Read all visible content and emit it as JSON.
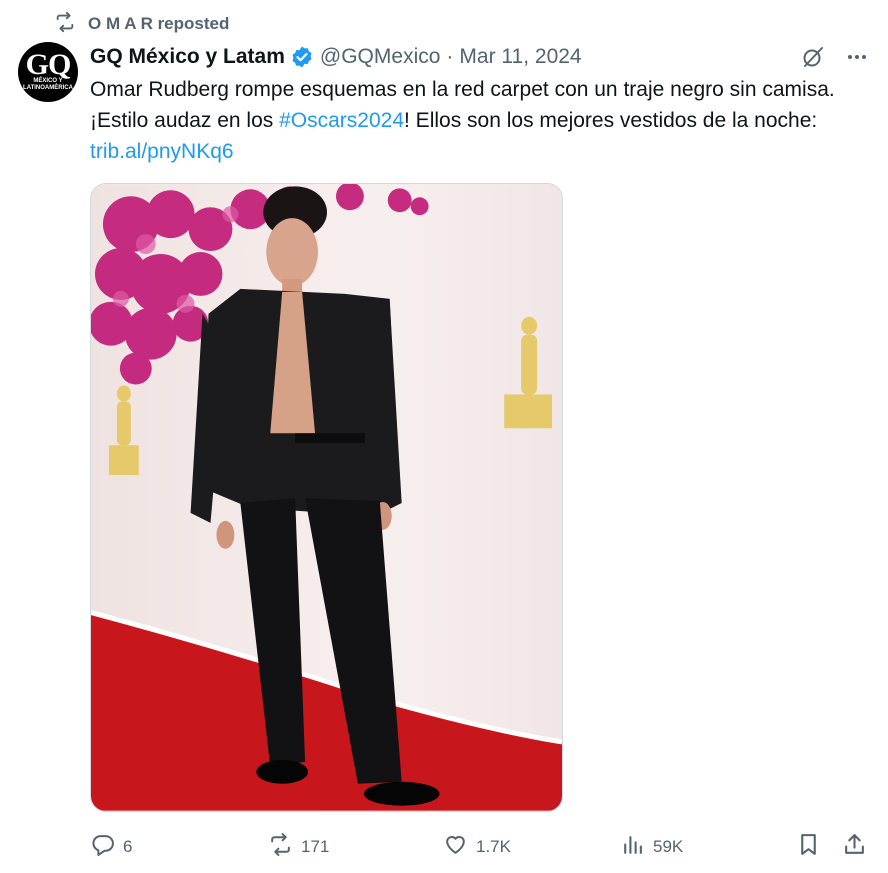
{
  "repost": {
    "label": "O M A R reposted"
  },
  "avatar": {
    "logo_text": "GQ",
    "logo_sub": "MÉXICO Y LATINOAMÉRICA"
  },
  "author": {
    "name": "GQ México y Latam",
    "handle": "@GQMexico",
    "separator": "·",
    "date": "Mar 11, 2024"
  },
  "tweet": {
    "text_part1": "Omar Rudberg rompe esquemas en la red carpet con un traje negro sin camisa. ¡Estilo audaz en los ",
    "hashtag": "#Oscars2024",
    "text_part2": "! Ellos son los mejores vestidos de la noche: ",
    "link": "trib.al/pnyNKq6"
  },
  "actions": {
    "replies": "6",
    "reposts": "171",
    "likes": "1.7K",
    "views": "59K"
  },
  "colors": {
    "link": "#1d9bf0",
    "muted": "#536471",
    "verified": "#1d9bf0",
    "carpet": "#c8171c",
    "flowers": "#c2217a"
  },
  "icons": [
    "repost-icon",
    "verified-badge-icon",
    "grok-icon",
    "more-icon",
    "reply-icon",
    "repost-icon",
    "like-icon",
    "views-icon",
    "bookmark-icon",
    "share-icon"
  ]
}
